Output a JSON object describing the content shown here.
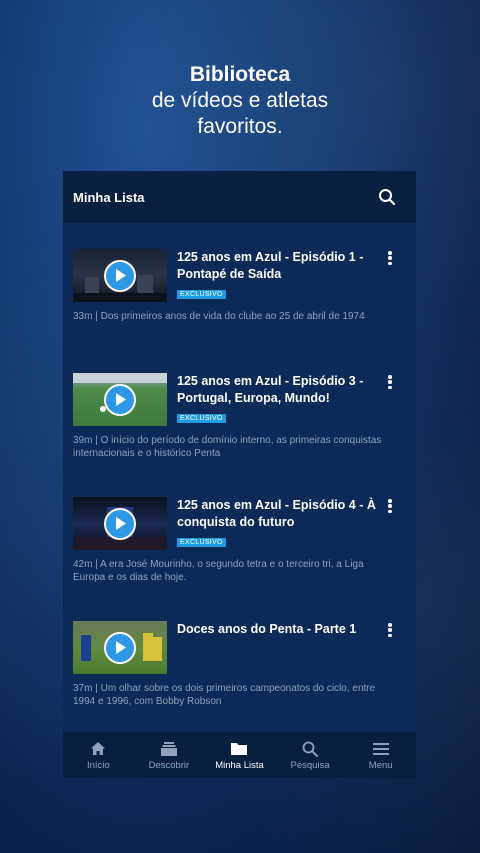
{
  "hero": {
    "line1": "Biblioteca",
    "line2": "de vídeos e atletas",
    "line3": "favoritos."
  },
  "topbar": {
    "title": "Minha Lista"
  },
  "items": [
    {
      "title": "125 anos em Azul - Episódio 1 - Pontapé de Saída",
      "badge": "EXCLUSIVO",
      "desc": "33m | Dos primeiros anos de vida do clube ao 25 de abril de 1974"
    },
    {
      "title": "125 anos em Azul - Episódio 3 - Portugal, Europa, Mundo!",
      "badge": "EXCLUSIVO",
      "desc": "39m | O início do período de domínio interno, as primeiras conquistas internacionais e o histórico Penta"
    },
    {
      "title": "125 anos em Azul - Episódio 4 - À conquista do futuro",
      "badge": "EXCLUSIVO",
      "desc": "42m | A era José Mourinho, o segundo tetra e o terceiro tri, a Liga Europa e os dias de hoje."
    },
    {
      "title": "Doces anos do Penta - Parte 1",
      "badge": "",
      "desc": "37m | Um olhar sobre os dois primeiros campeonatos do ciclo, entre 1994 e 1996, com Bobby Robson"
    }
  ],
  "nav": [
    {
      "label": "Início",
      "icon": "home-icon"
    },
    {
      "label": "Descobrir",
      "icon": "discover-icon"
    },
    {
      "label": "Minha Lista",
      "icon": "folder-icon",
      "active": true
    },
    {
      "label": "Pesquisa",
      "icon": "search-icon"
    },
    {
      "label": "Menu",
      "icon": "menu-icon"
    }
  ],
  "colors": {
    "accent": "#1f9be5",
    "bg": "#0c2a57",
    "bar": "#08203f"
  }
}
